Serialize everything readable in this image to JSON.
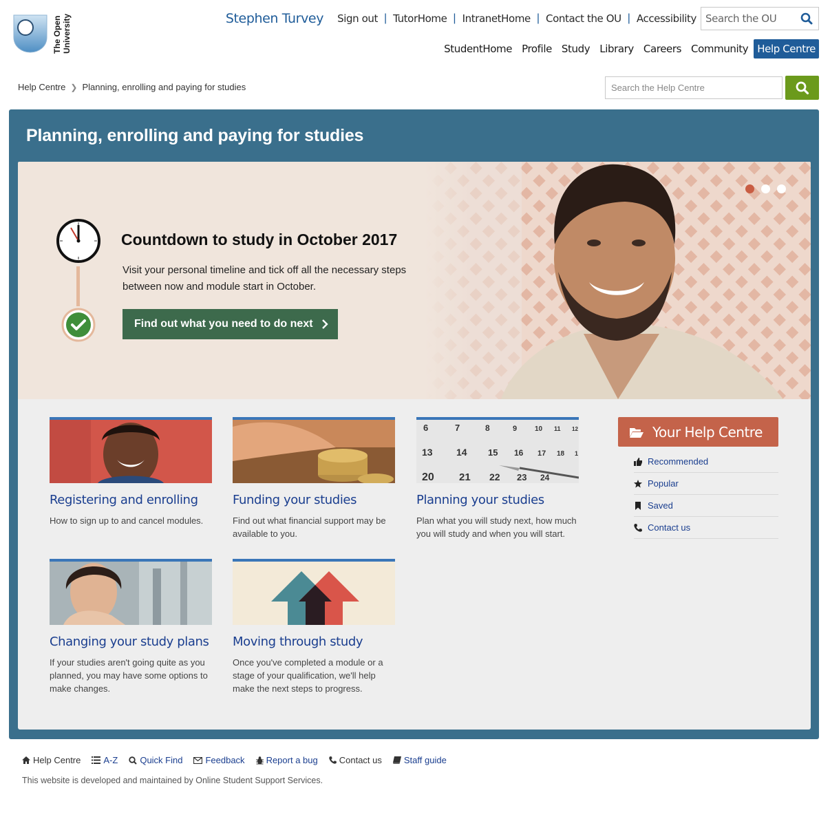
{
  "logo": {
    "line1": "The Open",
    "line2": "University"
  },
  "header": {
    "user_name": "Stephen Turvey",
    "links": [
      "Sign out",
      "TutorHome",
      "IntranetHome",
      "Contact the OU",
      "Accessibility"
    ],
    "search_placeholder": "Search the OU"
  },
  "nav": {
    "items": [
      "StudentHome",
      "Profile",
      "Study",
      "Library",
      "Careers",
      "Community",
      "Help Centre"
    ],
    "active": "Help Centre"
  },
  "breadcrumb": {
    "root": "Help Centre",
    "current": "Planning, enrolling and paying for studies"
  },
  "help_search": {
    "placeholder": "Search the Help Centre"
  },
  "page": {
    "title": "Planning, enrolling and paying for studies"
  },
  "hero": {
    "heading": "Countdown to study in October 2017",
    "text": "Visit your personal timeline and tick off all the necessary steps between now and module start in October.",
    "button_label": "Find out what you need to do next",
    "slides": 3,
    "active_slide": 1
  },
  "cards": [
    {
      "title": "Registering and enrolling",
      "desc": "How to sign up to and cancel modules."
    },
    {
      "title": "Funding your studies",
      "desc": "Find out what financial support may be available to you."
    },
    {
      "title": "Planning your studies",
      "desc": "Plan what you will study next, how much you will study and when you will start."
    },
    {
      "title": "Changing your study plans",
      "desc": "If your studies aren't going quite as you planned, you may have some options to make changes."
    },
    {
      "title": "Moving through study",
      "desc": "Once you've completed a module or a stage of your qualification, we'll help make the next steps to progress."
    }
  ],
  "calendar_numbers": [
    "6",
    "7",
    "8",
    "9",
    "10",
    "11",
    "12",
    "13",
    "14",
    "15",
    "16",
    "17",
    "18",
    "1",
    "20",
    "21",
    "22",
    "23",
    "24"
  ],
  "your_help_centre": {
    "label": "Your Help Centre",
    "items": [
      {
        "label": "Recommended",
        "icon": "thumbs-up-icon"
      },
      {
        "label": "Popular",
        "icon": "star-icon"
      },
      {
        "label": "Saved",
        "icon": "bookmark-icon"
      },
      {
        "label": "Contact us",
        "icon": "phone-icon"
      }
    ]
  },
  "footer": {
    "links": [
      "Help Centre",
      "A-Z",
      "Quick Find",
      "Feedback",
      "Report a bug",
      "Contact us",
      "Staff guide"
    ],
    "note": "This website is developed and maintained by Online Student Support Services."
  },
  "colors": {
    "brand_blue": "#1f5c99",
    "panel_blue": "#3a6f8c",
    "link_blue": "#1a3e8f",
    "green_button": "#3d6a4c",
    "search_green": "#6b9a1c",
    "accent_orange": "#c4634a"
  }
}
